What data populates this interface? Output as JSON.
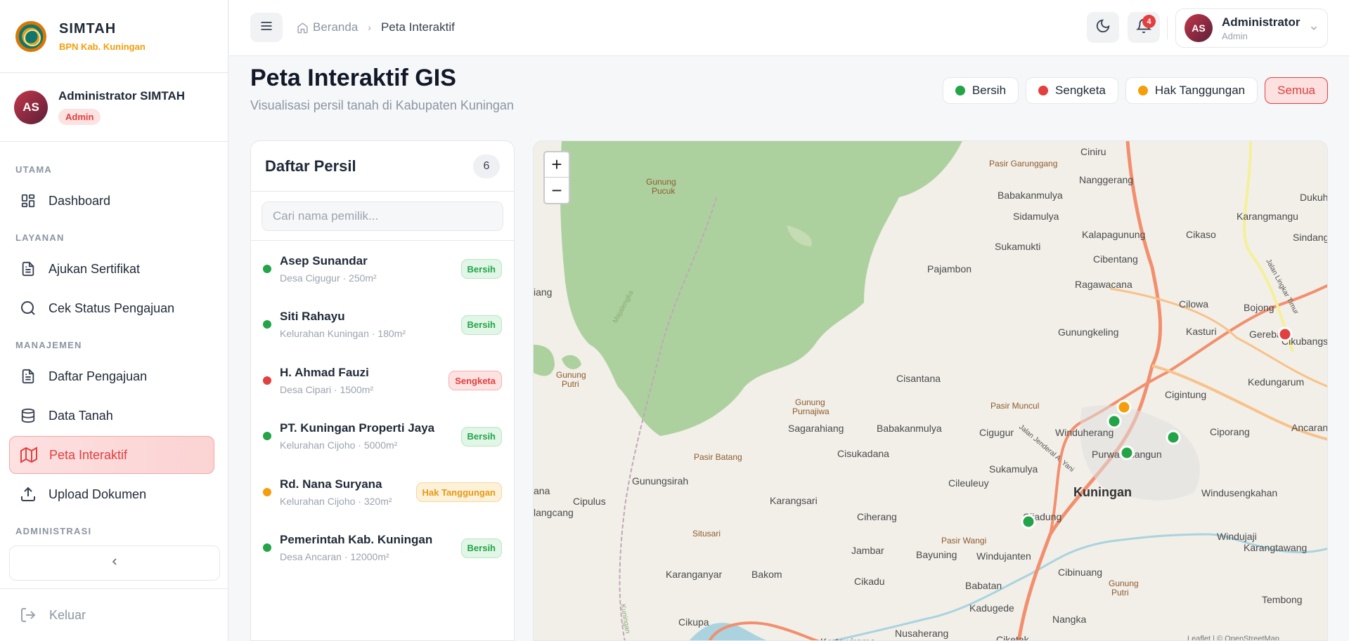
{
  "brand": {
    "title": "SIMTAH",
    "subtitle": "BPN Kab. Kuningan"
  },
  "sidebar_user": {
    "initials": "AS",
    "name": "Administrator SIMTAH",
    "role": "Admin"
  },
  "nav": {
    "sections": [
      "UTAMA",
      "LAYANAN",
      "MANAJEMEN",
      "ADMINISTRASI"
    ],
    "items": [
      {
        "label": "Dashboard",
        "icon": "grid-icon"
      },
      {
        "label": "Ajukan Sertifikat",
        "icon": "document-icon"
      },
      {
        "label": "Cek Status Pengajuan",
        "icon": "search-icon"
      },
      {
        "label": "Daftar Pengajuan",
        "icon": "document-icon"
      },
      {
        "label": "Data Tanah",
        "icon": "database-icon"
      },
      {
        "label": "Peta Interaktif",
        "icon": "map-icon",
        "active": true
      },
      {
        "label": "Upload Dokumen",
        "icon": "upload-icon"
      }
    ],
    "logout": "Keluar"
  },
  "topbar": {
    "breadcrumb_home": "Beranda",
    "breadcrumb_current": "Peta Interaktif",
    "notification_count": "4",
    "user_initials": "AS",
    "user_name": "Administrator",
    "user_role": "Admin"
  },
  "page": {
    "title": "Peta Interaktif GIS",
    "subtitle": "Visualisasi persil tanah di Kabupaten Kuningan"
  },
  "legend": [
    {
      "label": "Bersih",
      "color": "#22a447"
    },
    {
      "label": "Sengketa",
      "color": "#e2403e"
    },
    {
      "label": "Hak Tanggungan",
      "color": "#f59e0b"
    },
    {
      "label": "Semua",
      "active": true
    }
  ],
  "parcel_list": {
    "title": "Daftar Persil",
    "count": "6",
    "search_placeholder": "Cari nama pemilik...",
    "items": [
      {
        "name": "Asep Sunandar",
        "meta": "Desa Cigugur · 250m²",
        "status": "Bersih",
        "color": "#22a447"
      },
      {
        "name": "Siti Rahayu",
        "meta": "Kelurahan Kuningan · 180m²",
        "status": "Bersih",
        "color": "#22a447"
      },
      {
        "name": "H. Ahmad Fauzi",
        "meta": "Desa Cipari · 1500m²",
        "status": "Sengketa",
        "color": "#e2403e"
      },
      {
        "name": "PT. Kuningan Properti Jaya",
        "meta": "Kelurahan Cijoho · 5000m²",
        "status": "Bersih",
        "color": "#22a447"
      },
      {
        "name": "Rd. Nana Suryana",
        "meta": "Kelurahan Cijoho · 320m²",
        "status": "Hak Tanggungan",
        "color": "#f59e0b"
      },
      {
        "name": "Pemerintah Kab. Kuningan",
        "meta": "Desa Ancaran · 12000m²",
        "status": "Bersih",
        "color": "#22a447"
      }
    ]
  },
  "map": {
    "zoom_in": "+",
    "zoom_out": "−",
    "labels": [
      "Gunung Pucuk",
      "Pasir Garunggang",
      "Ciniru",
      "Nanggerang",
      "Babakanmulya",
      "Sidamulya",
      "Dukuh",
      "Karangmangu",
      "Sindangba",
      "Sukamukti",
      "Kalapagunung",
      "Cikaso",
      "Pajambon",
      "Cibentang",
      "Ragawacana",
      "Cilowa",
      "Bojong",
      "Gereba",
      "Cikubangs",
      "Gunungkeling",
      "Kasturi",
      "Kedungarum",
      "Cisantana",
      "Cigintung",
      "Ancaran",
      "Gunung Putri",
      "Gunung Purnajiwa",
      "Pasir Muncul",
      "Sagarahiang",
      "Babakanmulya",
      "Cigugur",
      "Winduherang",
      "Ciporang",
      "Cisukadana",
      "Purwawinangun",
      "Pasir Batang",
      "Sukamulya",
      "Gunungsirah",
      "Cileuleuy",
      "Kuningan",
      "Windusengkahan",
      "Cipulus",
      "Karangsari",
      "Ciherang",
      "Cijadung",
      "Situsari",
      "Pasir Wangi",
      "Windujanten",
      "Windujaji",
      "Karangtawang",
      "Jambar",
      "Bayuning",
      "Cibinuang",
      "Gunung Putri",
      "Karanganyar",
      "Bakom",
      "Cikadu",
      "Babatan",
      "Tembong",
      "Kadugede",
      "Cikupa",
      "Nangka",
      "Kertawirama",
      "Nusaherang",
      "Ciketak",
      "Majalengka",
      "Kuningan",
      "Jalan Jenderal A. Yani",
      "Jalan Lingkar Timur",
      "iang",
      "ana",
      "langcang",
      "Leaflet | © OpenStreetMap"
    ]
  }
}
